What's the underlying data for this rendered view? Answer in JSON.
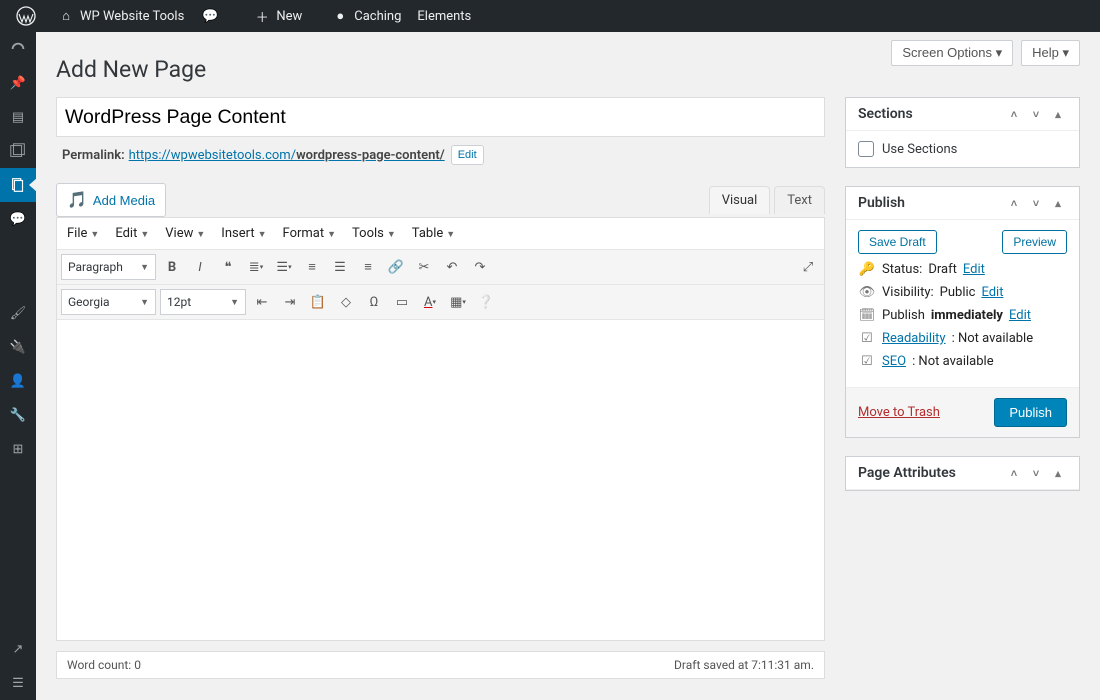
{
  "toolbar": {
    "site": "WP Website Tools",
    "new": "New",
    "caching": "Caching",
    "elements": "Elements"
  },
  "topright": {
    "screen_options": "Screen Options",
    "help": "Help"
  },
  "page": {
    "heading": "Add New Page",
    "title_value": "WordPress Page Content",
    "permalink_label": "Permalink:",
    "permalink_base": "https://wpwebsitetools.com/",
    "permalink_slug": "wordpress-page-content/",
    "permalink_edit": "Edit"
  },
  "editor": {
    "add_media": "Add Media",
    "tabs": {
      "visual": "Visual",
      "text": "Text"
    },
    "menu": [
      "File",
      "Edit",
      "View",
      "Insert",
      "Format",
      "Tools",
      "Table"
    ],
    "block_format": "Paragraph",
    "font_family": "Georgia",
    "font_size": "12pt",
    "word_count_label": "Word count: ",
    "word_count": 0,
    "draft_saved": "Draft saved at 7:11:31 am."
  },
  "sections_box": {
    "title": "Sections",
    "use_sections": "Use Sections"
  },
  "publish_box": {
    "title": "Publish",
    "save_draft": "Save Draft",
    "preview": "Preview",
    "status_label": "Status:",
    "status_value": "Draft",
    "visibility_label": "Visibility:",
    "visibility_value": "Public",
    "schedule_label": "Publish",
    "schedule_value": "immediately",
    "edit": "Edit",
    "readability_label": "Readability",
    "readability_value": ": Not available",
    "seo_label": "SEO",
    "seo_value": ": Not available",
    "trash": "Move to Trash",
    "publish": "Publish"
  },
  "attr_box": {
    "title": "Page Attributes"
  }
}
